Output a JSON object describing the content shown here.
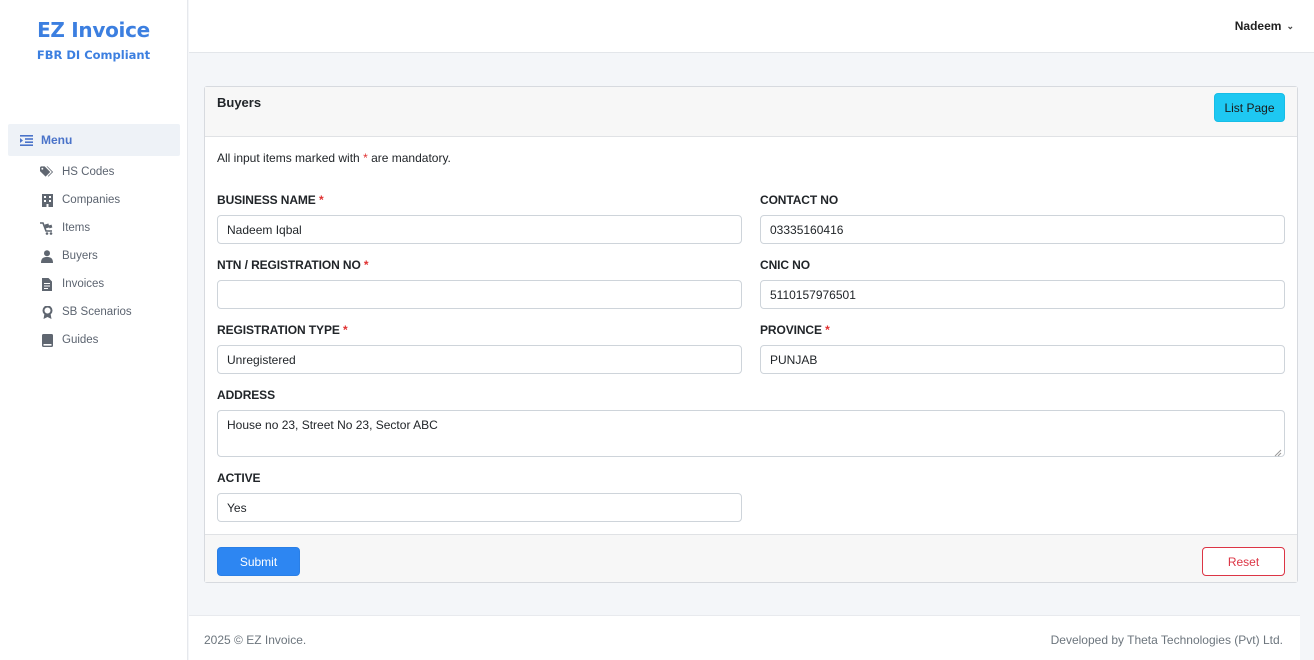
{
  "brand": {
    "title": "EZ Invoice",
    "subtitle": "FBR DI Compliant"
  },
  "sidebar": {
    "menu_label": "Menu",
    "items": [
      {
        "label": "HS Codes",
        "icon": "tags-icon"
      },
      {
        "label": "Companies",
        "icon": "building-icon"
      },
      {
        "label": "Items",
        "icon": "cart-icon"
      },
      {
        "label": "Buyers",
        "icon": "user-icon"
      },
      {
        "label": "Invoices",
        "icon": "document-icon"
      },
      {
        "label": "SB Scenarios",
        "icon": "award-icon"
      },
      {
        "label": "Guides",
        "icon": "book-icon"
      }
    ]
  },
  "topbar": {
    "user_name": "Nadeem",
    "user_chevron": "⌄"
  },
  "card": {
    "title": "Buyers",
    "list_button": "List Page",
    "note_before": "All input items marked with",
    "note_star": "*",
    "note_after": "are mandatory.",
    "required_mark": "*"
  },
  "form": {
    "business_name": {
      "label": "BUSINESS NAME",
      "value": "Nadeem Iqbal",
      "required": true
    },
    "contact_no": {
      "label": "CONTACT NO",
      "value": "03335160416",
      "required": false
    },
    "ntn": {
      "label": "NTN / REGISTRATION NO",
      "value": "",
      "required": true
    },
    "cnic": {
      "label": "CNIC NO",
      "value": "5110157976501",
      "required": false
    },
    "registration_type": {
      "label": "REGISTRATION TYPE",
      "value": "Unregistered",
      "required": true
    },
    "province": {
      "label": "PROVINCE",
      "value": "PUNJAB",
      "required": true
    },
    "address": {
      "label": "ADDRESS",
      "value": "House no 23, Street No 23, Sector ABC",
      "required": false
    },
    "active": {
      "label": "ACTIVE",
      "value": "Yes",
      "required": false
    }
  },
  "actions": {
    "submit": "Submit",
    "reset": "Reset"
  },
  "footer": {
    "left": "2025 © EZ Invoice.",
    "right": "Developed by Theta Technologies (Pvt) Ltd."
  },
  "colors": {
    "brand": "#3c7fe0",
    "primary": "#2d86f2",
    "info": "#1ec8f2",
    "danger": "#dc3545",
    "required": "#e03131"
  }
}
